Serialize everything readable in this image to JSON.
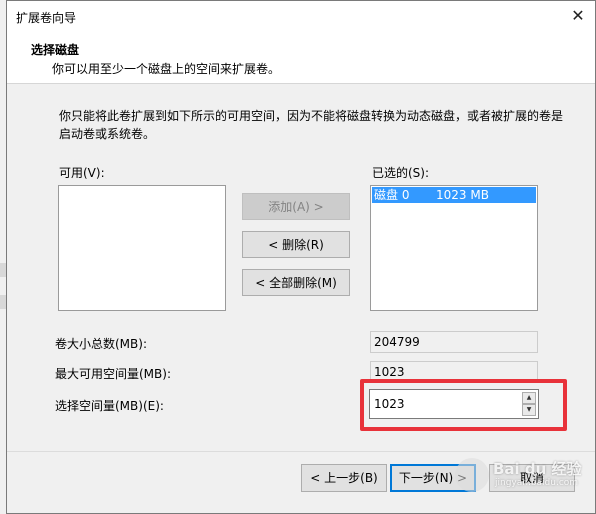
{
  "dialog": {
    "title": "扩展卷向导",
    "close_glyph": "✕",
    "header_title": "选择磁盘",
    "header_subtitle": "你可以用至少一个磁盘上的空间来扩展卷。",
    "description": "你只能将此卷扩展到如下所示的可用空间，因为不能将磁盘转换为动态磁盘，或者被扩展的卷是启动卷或系统卷。"
  },
  "available": {
    "label": "可用(V):",
    "items": []
  },
  "selected": {
    "label": "已选的(S):",
    "items": [
      {
        "disk": "磁盘 0",
        "size": "1023 MB",
        "selected": true
      }
    ]
  },
  "buttons": {
    "add": "添加(A) >",
    "remove": "< 删除(R)",
    "remove_all": "< 全部删除(M)",
    "back": "< 上一步(B)",
    "next": "下一步(N) >",
    "cancel": "取消"
  },
  "fields": {
    "total_label": "卷大小总数(MB):",
    "total_value": "204799",
    "max_label": "最大可用空间量(MB):",
    "max_value": "1023",
    "select_label": "选择空间量(MB)(E):",
    "select_value": "1023"
  },
  "annotation": {
    "highlight_color": "#e8323a"
  },
  "watermark": {
    "brand": "Bai du 经验",
    "url": "jingyan.baidu.com"
  },
  "colors": {
    "selection": "#3399ff",
    "default_button_border": "#0078d7"
  }
}
